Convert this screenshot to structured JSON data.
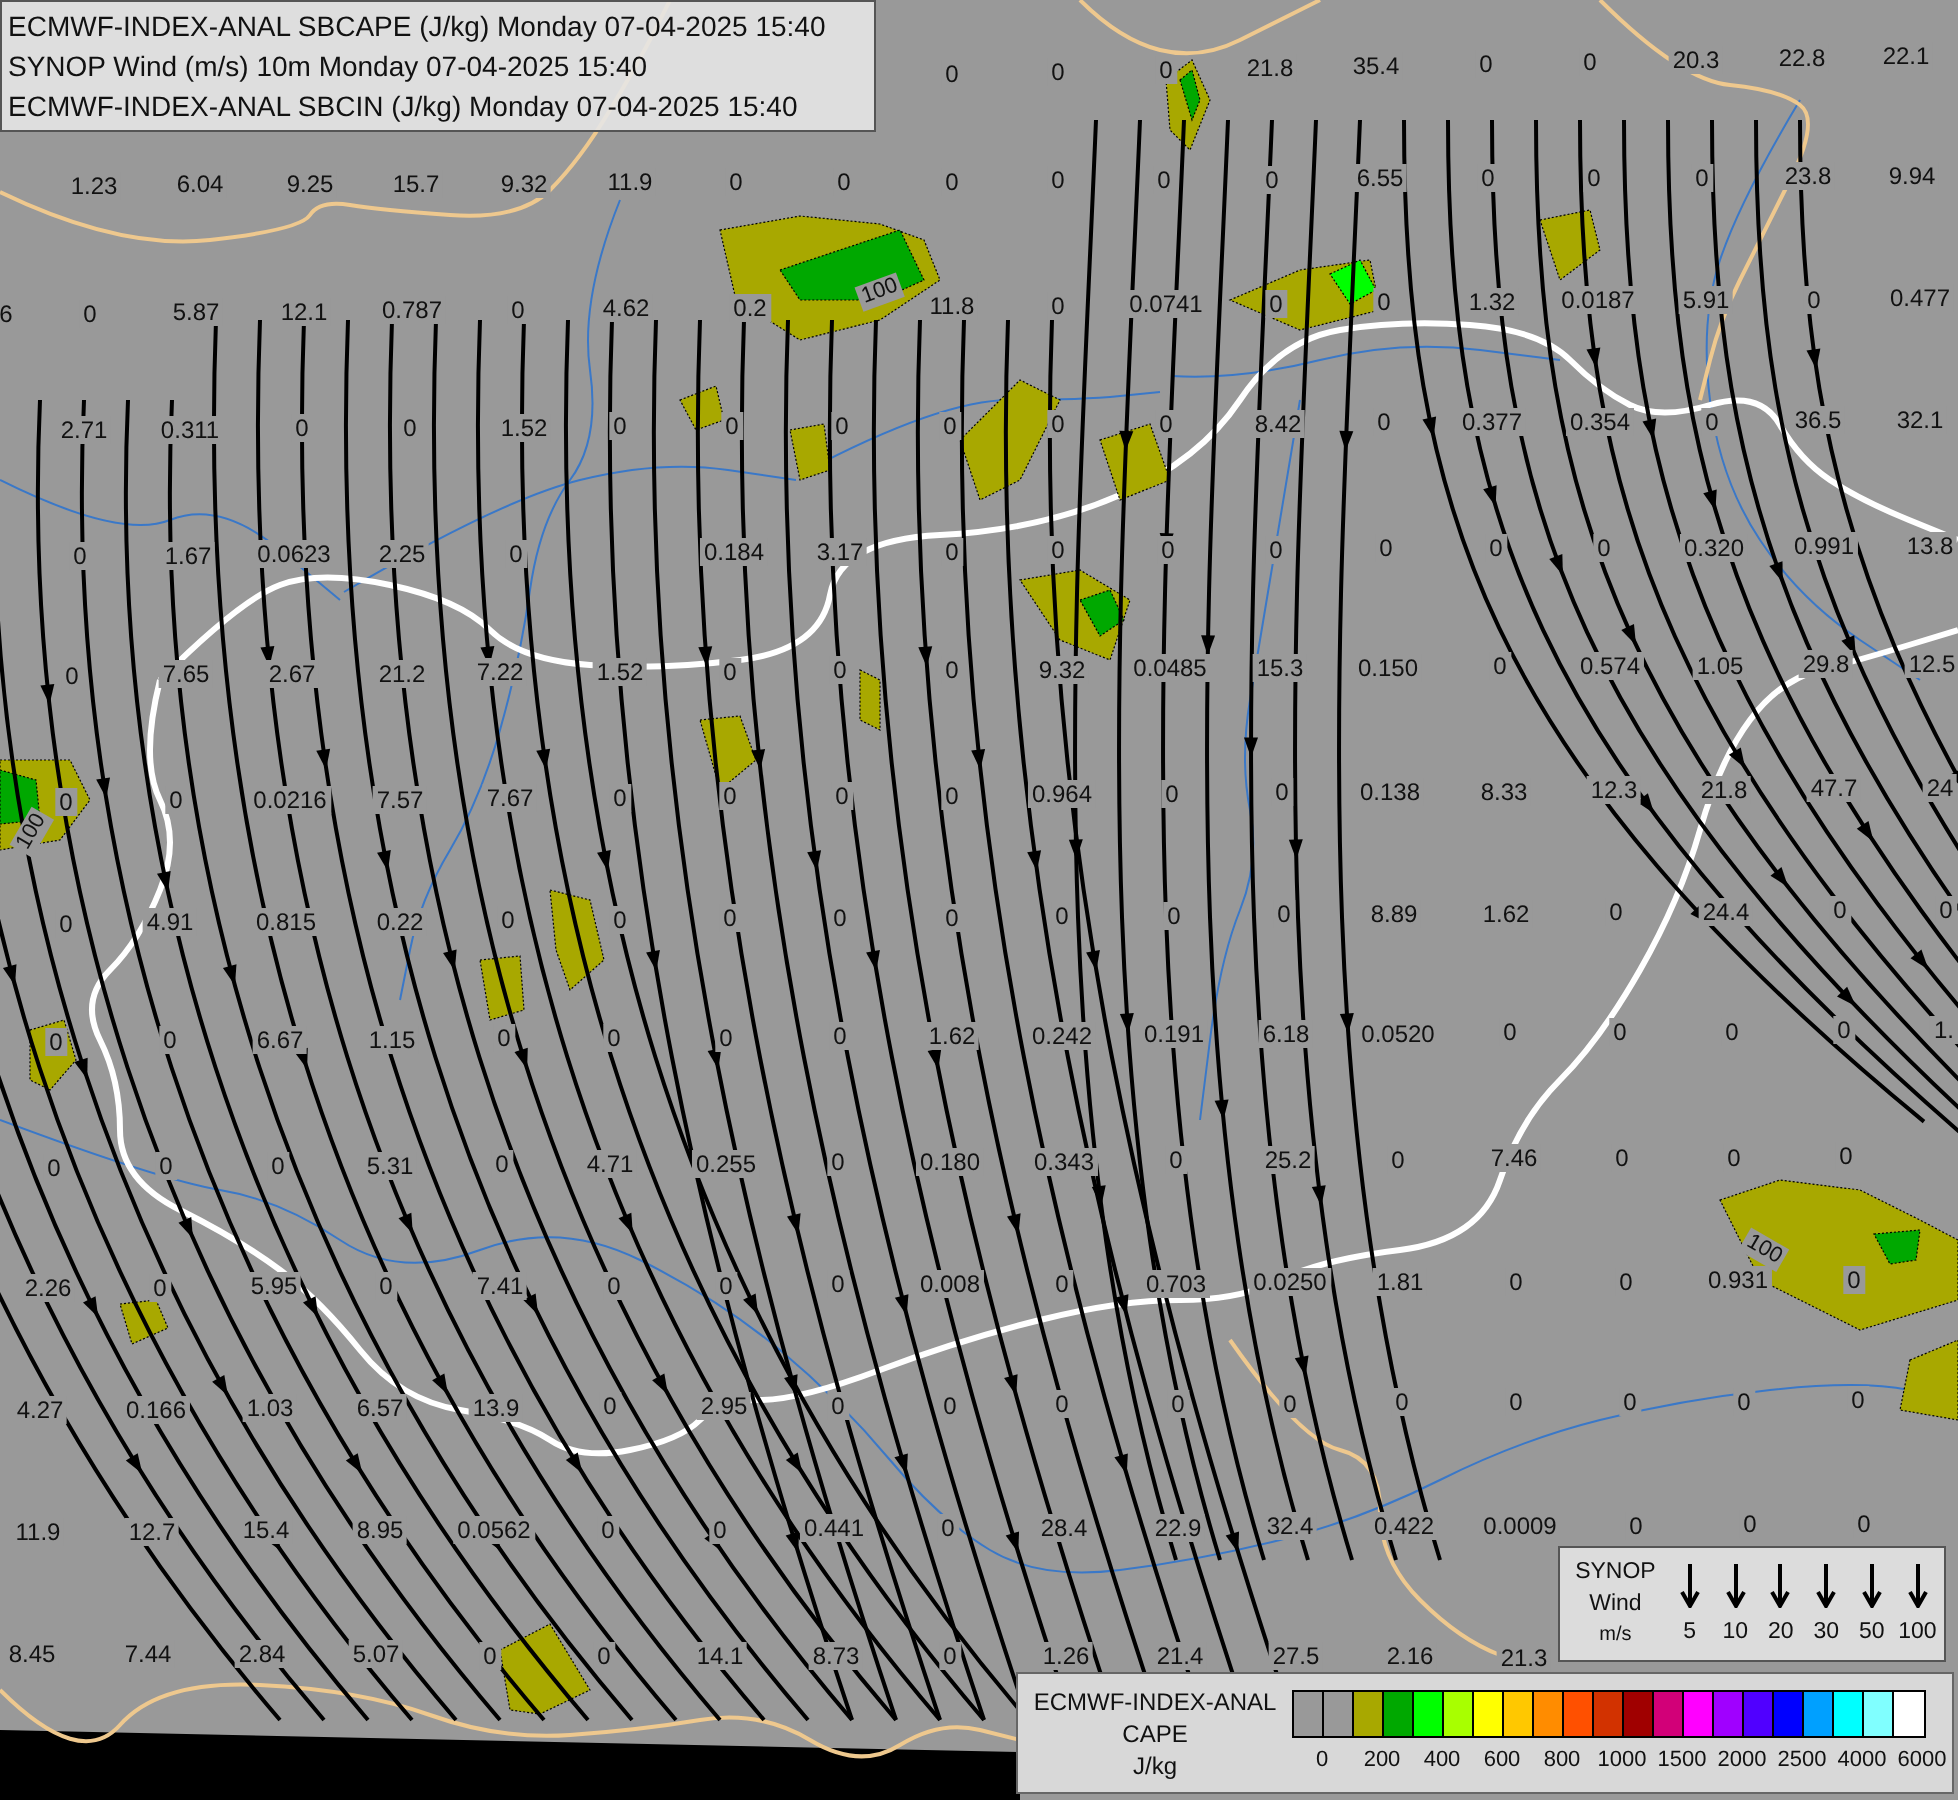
{
  "header": {
    "lines": [
      "ECMWF-INDEX-ANAL SBCAPE (J/kg) Monday 07-04-2025 15:40",
      "SYNOP Wind (m/s) 10m Monday 07-04-2025 15:40",
      "ECMWF-INDEX-ANAL SBCIN (J/kg) Monday 07-04-2025 15:40"
    ]
  },
  "map": {
    "value_rows": [
      [
        "0",
        "0",
        "0",
        "21.8",
        "35.4",
        "0",
        "0",
        "20.3",
        "22.8",
        "22.1"
      ],
      [
        "1.23",
        "6.04",
        "9.25",
        "15.7",
        "9.32",
        "11.9",
        "0",
        "0",
        "0",
        "0",
        "0",
        "0",
        "6.55",
        "0",
        "0",
        "0",
        "23.8",
        "9.94"
      ],
      [
        "6",
        "0",
        "5.87",
        "12.1",
        "0.787",
        "0",
        "4.62",
        "0.2",
        "11.8",
        "0",
        "0.0741",
        "0",
        "0",
        "1.32",
        "0.0187",
        "5.91",
        "0",
        "0.477"
      ],
      [
        "2.71",
        "0.311",
        "0",
        "0",
        "1.52",
        "0",
        "0",
        "0",
        "0",
        "0",
        "0",
        "8.42",
        "0",
        "0.377",
        "0.354",
        "0",
        "36.5",
        "32.1"
      ],
      [
        "0",
        "1.67",
        "0.0623",
        "2.25",
        "0",
        "0.184",
        "3.17",
        "0",
        "0",
        "0",
        "0",
        "0",
        "0",
        "0",
        "0.320",
        "0.991",
        "13.8"
      ],
      [
        "0",
        "7.65",
        "2.67",
        "21.2",
        "7.22",
        "1.52",
        "0",
        "0",
        "0",
        "9.32",
        "0.0485",
        "15.3",
        "0.150",
        "0",
        "0.574",
        "1.05",
        "29.8",
        "12.5"
      ],
      [
        "0",
        "0",
        "0.0216",
        "7.57",
        "7.67",
        "0",
        "0",
        "0",
        "0",
        "0.964",
        "0",
        "0",
        "0.138",
        "8.33",
        "12.3",
        "21.8",
        "47.7",
        "24"
      ],
      [
        "0",
        "4.91",
        "0.815",
        "0.22",
        "0",
        "0",
        "0",
        "0",
        "0",
        "0",
        "0",
        "0",
        "8.89",
        "1.62",
        "0",
        "24.4",
        "0",
        "0"
      ],
      [
        "0",
        "0",
        "6.67",
        "1.15",
        "0",
        "0",
        "0",
        "0",
        "1.62",
        "0.242",
        "0.191",
        "6.18",
        "0.0520",
        "0",
        "0",
        "0",
        "0",
        "1."
      ],
      [
        "0",
        "0",
        "0",
        "5.31",
        "0",
        "4.71",
        "0.255",
        "0",
        "0.180",
        "0.343",
        "0",
        "25.2",
        "0",
        "7.46",
        "0",
        "0",
        "0"
      ],
      [
        "2.26",
        "0",
        "5.95",
        "0",
        "7.41",
        "0",
        "0",
        "0",
        "0.008",
        "0",
        "0.703",
        "0.0250",
        "1.81",
        "0",
        "0",
        "0.931",
        "0"
      ],
      [
        "4.27",
        "0.166",
        "1.03",
        "6.57",
        "13.9",
        "0",
        "2.95",
        "0",
        "0",
        "0",
        "0",
        "0",
        "0",
        "0",
        "0",
        "0",
        "0"
      ],
      [
        "11.9",
        "12.7",
        "15.4",
        "8.95",
        "0.0562",
        "0",
        "0",
        "0.441",
        "0",
        "28.4",
        "22.9",
        "32.4",
        "0.422",
        "0.0009",
        "0",
        "0",
        "0"
      ],
      [
        "8.45",
        "7.44",
        "2.84",
        "5.07",
        "0",
        "0",
        "14.1",
        "8.73",
        "0",
        "1.26",
        "21.4",
        "27.5",
        "2.16",
        "21.3"
      ]
    ],
    "contour_labels": [
      "100",
      "100",
      "100"
    ]
  },
  "synop_legend": {
    "title_lines": [
      "SYNOP",
      "Wind",
      "m/s"
    ],
    "speeds": [
      "5",
      "10",
      "20",
      "30",
      "50",
      "100"
    ]
  },
  "cape_legend": {
    "title_lines": [
      "ECMWF-INDEX-ANAL",
      "CAPE",
      "J/kg"
    ],
    "colors": [
      {
        "color": "#999999"
      },
      {
        "color": "#999999"
      },
      {
        "color": "#a8a800"
      },
      {
        "color": "#00a800"
      },
      {
        "color": "#00ff00"
      },
      {
        "color": "#a8ff00"
      },
      {
        "color": "#ffff00"
      },
      {
        "color": "#ffc800"
      },
      {
        "color": "#ff8c00"
      },
      {
        "color": "#ff5000"
      },
      {
        "color": "#d23200"
      },
      {
        "color": "#a00000"
      },
      {
        "color": "#d20078"
      },
      {
        "color": "#ff00ff"
      },
      {
        "color": "#a000ff"
      },
      {
        "color": "#5000ff"
      },
      {
        "color": "#0000ff"
      },
      {
        "color": "#00a0ff"
      },
      {
        "color": "#00ffff"
      },
      {
        "color": "#80ffff"
      },
      {
        "color": "#ffffff"
      }
    ],
    "ticks": [
      "0",
      "200",
      "400",
      "600",
      "800",
      "1000",
      "1500",
      "2000",
      "2500",
      "4000",
      "6000"
    ]
  }
}
